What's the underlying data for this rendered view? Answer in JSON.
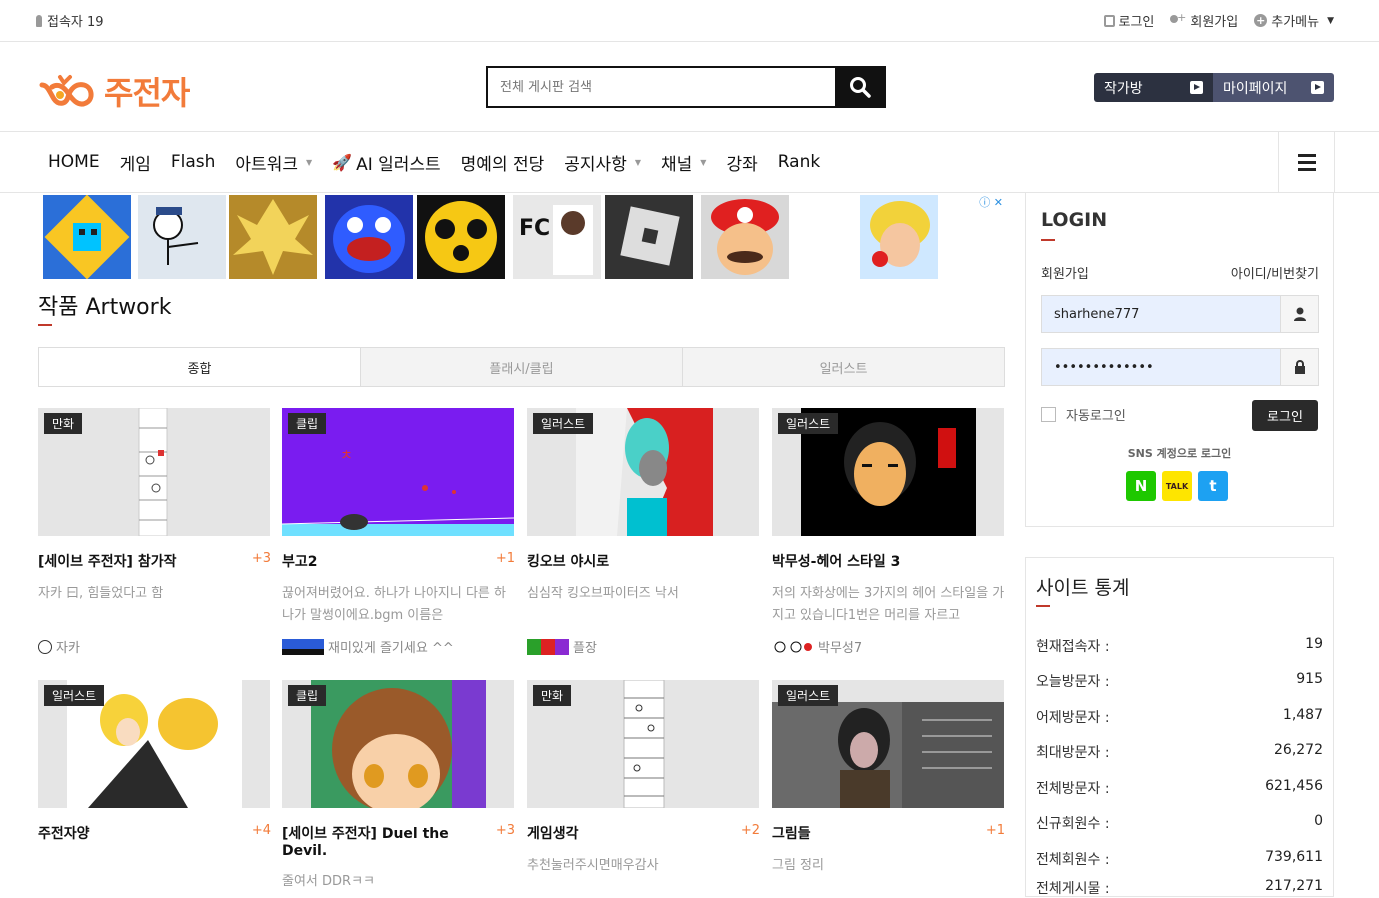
{
  "topbar": {
    "visitors": "접속자 19",
    "login": "로그인",
    "signup": "회원가입",
    "more_menu": "추가메뉴"
  },
  "header": {
    "logo_text": "주전자",
    "search_placeholder": "전체 게시판 검색",
    "writer_room": "작가방",
    "my_page": "마이페이지"
  },
  "nav": {
    "items": [
      {
        "label": "HOME"
      },
      {
        "label": "게임"
      },
      {
        "label": "Flash"
      },
      {
        "label": "아트워크"
      },
      {
        "label": "AI 일러스트"
      },
      {
        "label": "명예의 전당"
      },
      {
        "label": "공지사항"
      },
      {
        "label": "채널"
      },
      {
        "label": "강좌"
      },
      {
        "label": "Rank"
      }
    ]
  },
  "section": {
    "title": "작품 Artwork",
    "tabs": [
      {
        "label": "종합"
      },
      {
        "label": "플래시/클립"
      },
      {
        "label": "일러스트"
      }
    ]
  },
  "cards": [
    {
      "badge": "만화",
      "title": "[세이브 주전자] 참가작",
      "count": "+3",
      "desc": "자카 曰, 힘들었다고 함",
      "author": "자카"
    },
    {
      "badge": "클립",
      "title": "부고2",
      "count": "+1",
      "desc": "끊어져버렸어요. 하나가 나아지니 다른 하나가 말썽이에요.bgm 이름은",
      "author": "재미있게 즐기세요 ^^"
    },
    {
      "badge": "일러스트",
      "title": "킹오브 야시로",
      "count": "",
      "desc": "심심작 킹오브파이터즈 낙서",
      "author": "플장"
    },
    {
      "badge": "일러스트",
      "title": "박무성-헤어 스타일 3",
      "count": "",
      "desc": "저의 자화상에는 3가지의 헤어 스타일을 가지고 있습니다1번은 머리를 자르고",
      "author": "박무성7"
    },
    {
      "badge": "일러스트",
      "title": "주전자양",
      "count": "+4",
      "desc": "",
      "author": ""
    },
    {
      "badge": "클립",
      "title": "[세이브 주전자] Duel the Devil.",
      "count": "+3",
      "desc": "줄여서 DDRㅋㅋ",
      "author": ""
    },
    {
      "badge": "만화",
      "title": "게임생각",
      "count": "+2",
      "desc": "추천눌러주시면매우감사",
      "author": ""
    },
    {
      "badge": "일러스트",
      "title": "그림들",
      "count": "+1",
      "desc": "그림 정리",
      "author": ""
    }
  ],
  "login": {
    "title": "LOGIN",
    "signup": "회원가입",
    "find": "아이디/비번찾기",
    "username": "sharhene777",
    "password": "•••••••••••••",
    "auto_login": "자동로그인",
    "button": "로그인",
    "sns_label": "SNS 계정으로 로그인",
    "sns": [
      "N",
      "TALK",
      "t"
    ]
  },
  "stats": {
    "title": "사이트 통계",
    "rows": [
      {
        "label": "현재접속자 :",
        "value": "19"
      },
      {
        "label": "오늘방문자 :",
        "value": "915"
      },
      {
        "label": "어제방문자 :",
        "value": "1,487"
      },
      {
        "label": "최대방문자 :",
        "value": "26,272"
      },
      {
        "label": "전체방문자 :",
        "value": "621,456"
      },
      {
        "label": "신규회원수 :",
        "value": "0"
      },
      {
        "label": "전체회원수 :",
        "value": "739,611"
      },
      {
        "label": "전체게시물 :",
        "value": "217,271"
      }
    ]
  },
  "colors": {
    "brand": "#f27b3a",
    "accent_bar": "#c0392b",
    "dark_btn": "#2c3140",
    "mypage_btn": "#4d5370"
  }
}
